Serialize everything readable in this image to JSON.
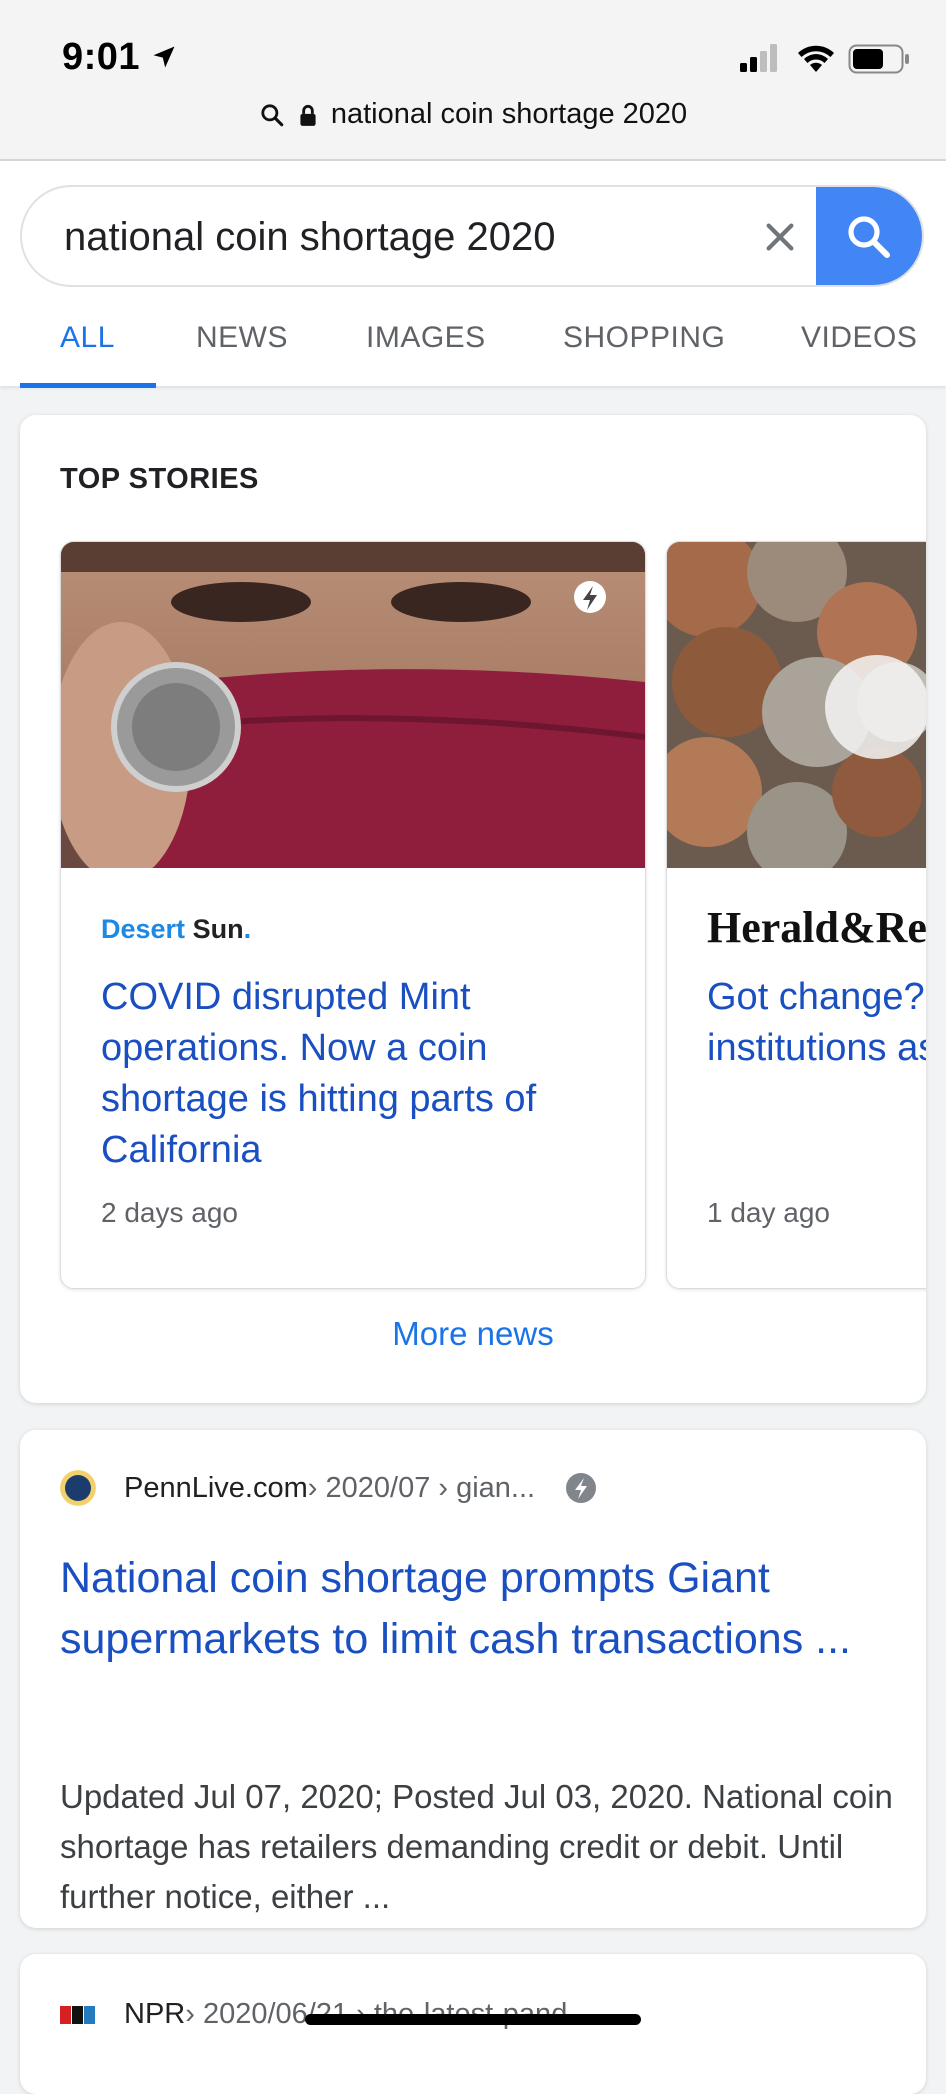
{
  "status": {
    "time": "9:01"
  },
  "url_bar": {
    "text": "national coin shortage 2020"
  },
  "search": {
    "query": "national coin shortage 2020"
  },
  "tabs": [
    {
      "label": "ALL",
      "active": true
    },
    {
      "label": "NEWS",
      "active": false
    },
    {
      "label": "IMAGES",
      "active": false
    },
    {
      "label": "SHOPPING",
      "active": false
    },
    {
      "label": "VIDEOS",
      "active": false
    }
  ],
  "top_stories": {
    "heading": "TOP STORIES",
    "stories": [
      {
        "source_part1": "Desert",
        "source_part2": "Sun",
        "source_dot": ".",
        "headline": "COVID disrupted Mint operations. Now a coin shortage is hitting parts of California",
        "time": "2 days ago",
        "amp": true
      },
      {
        "source": "Herald&Re",
        "headline": "Got change? shortage has institutions as customers to",
        "time": "1 day ago"
      }
    ],
    "more_label": "More news"
  },
  "results": [
    {
      "site": "PennLive.com",
      "path": " › 2020/07 › gian...",
      "title": "National coin shortage prompts Giant supermarkets to limit cash transactions ...",
      "snippet": "Updated Jul 07, 2020; Posted Jul 03, 2020. National coin shortage has retailers demanding credit or debit. Until further notice, either ...",
      "amp": true
    },
    {
      "site": "NPR",
      "path": " › 2020/06/21 › the-latest-pand..."
    }
  ],
  "colors": {
    "accent": "#1a73e8",
    "link": "#1a4fc2",
    "search_button": "#4285f4"
  }
}
